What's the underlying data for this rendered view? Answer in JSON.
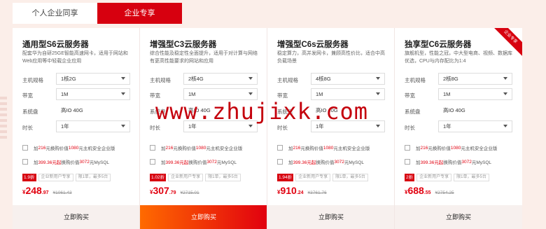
{
  "tabs": [
    {
      "label": "个人企业同享",
      "active": false
    },
    {
      "label": "企业专享",
      "active": true
    }
  ],
  "labels": {
    "spec": "主机规格",
    "bandwidth": "带宽",
    "disk": "系统盘",
    "duration": "时长",
    "buy": "立即购买"
  },
  "cards": [
    {
      "title": "通用型S6云服务器",
      "desc": "配套华为自研25GE智能高速网卡，适用于网站和Web应用等中轻载企业应用",
      "spec": "1核2G",
      "bandwidth": "1M",
      "disk": "高IO 40G",
      "duration": "1年",
      "addon1": {
        "pre": "加",
        "a": "216",
        "mid": "元换购价值",
        "b": "1080",
        "post": "元主机安全企业版"
      },
      "addon2": {
        "pre": "加",
        "a": "399.36元起",
        "mid": "换购价值",
        "b": "3072",
        "post": "元MySQL"
      },
      "discount": "1.9折",
      "tags": [
        "企业新用户专享",
        "限1单，最多5台"
      ],
      "price_int": "248",
      "price_dec": ".97",
      "yen": "¥",
      "orig_price": "¥1061.43"
    },
    {
      "title": "增强型C3云服务器",
      "desc": "综合性能及稳定性全面提升，适用于对计算与网络有更高性能要求的网站和应用",
      "spec": "2核4G",
      "bandwidth": "1M",
      "disk": "高IO 40G",
      "duration": "1年",
      "addon1": {
        "pre": "加",
        "a": "216",
        "mid": "元换购价值",
        "b": "1080",
        "post": "元主机安全企业版"
      },
      "addon2": {
        "pre": "加",
        "a": "399.36元起",
        "mid": "换购价值",
        "b": "3072",
        "post": "元MySQL"
      },
      "discount": "1.02折",
      "tags": [
        "企业新用户专享",
        "限1单，最多5台"
      ],
      "price_int": "307",
      "price_dec": ".79",
      "yen": "¥",
      "orig_price": "¥2715.01"
    },
    {
      "title": "增强型C6s云服务器",
      "desc": "稳定算力，高并发网卡，兼顾高性价比，适合中高负载场景",
      "spec": "4核8G",
      "bandwidth": "1M",
      "disk": "高IO 40G",
      "duration": "1年",
      "addon1": {
        "pre": "加",
        "a": "216",
        "mid": "元换购价值",
        "b": "1080",
        "post": "元主机安全企业版"
      },
      "addon2": {
        "pre": "加",
        "a": "399.36元起",
        "mid": "换购价值",
        "b": "3072",
        "post": "元MySQL"
      },
      "discount": "1.94折",
      "tags": [
        "企业新用户专享",
        "限1单，最多5台"
      ],
      "price_int": "910",
      "price_dec": ".24",
      "yen": "¥",
      "orig_price": "¥3761.76"
    },
    {
      "title": "独享型C6云服务器",
      "desc": "旗舰机型，性能之冠，中大型电商、视频、数据库优选，CPU与内存配比为1:4",
      "ribbon": "企业专享",
      "spec": "2核8G",
      "bandwidth": "1M",
      "disk": "高IO 40G",
      "duration": "1年",
      "addon1": {
        "pre": "加",
        "a": "216",
        "mid": "元换购价值",
        "b": "1080",
        "post": "元主机安全企业版"
      },
      "addon2": {
        "pre": "加",
        "a": "399.36元起",
        "mid": "换购价值",
        "b": "3072",
        "post": "元MySQL"
      },
      "discount": "2折",
      "tags": [
        "企业新用户专享",
        "限1单，最多5台"
      ],
      "price_int": "688",
      "price_dec": ".55",
      "yen": "¥",
      "orig_price": "¥2754.25"
    }
  ],
  "watermark": "www.zhujixk.com",
  "colors": {
    "accent": "#d7000f",
    "price": "#e1000f",
    "buy_hot_start": "#ff6a00"
  }
}
